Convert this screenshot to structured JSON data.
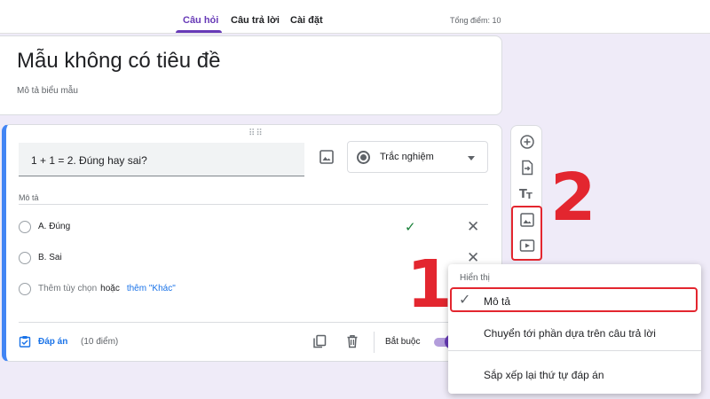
{
  "tabs": [
    {
      "label": "Câu hỏi",
      "active": true
    },
    {
      "label": "Câu trả lời",
      "active": false
    },
    {
      "label": "Cài đặt",
      "active": false
    }
  ],
  "total_points": "Tổng điểm: 10",
  "form": {
    "title": "Mẫu không có tiêu đề",
    "description_placeholder": "Mô tả biểu mẫu"
  },
  "question": {
    "text": "1 + 1 = 2. Đúng hay sai?",
    "type": "Trắc nghiệm",
    "description_placeholder": "Mô tả",
    "options": [
      {
        "label": "A. Đúng",
        "correct": true
      },
      {
        "label": "B. Sai",
        "correct": false
      }
    ],
    "add_option": "Thêm tùy chọn",
    "or_text": "hoặc",
    "add_other": "thêm \"Khác\"",
    "answer_key": "Đáp án",
    "points": "(10 điểm)",
    "required_label": "Bắt buộc",
    "required": true
  },
  "side_toolbar": [
    "add-question-icon",
    "import-questions-icon",
    "add-title-icon",
    "add-image-icon",
    "add-video-icon"
  ],
  "menu": {
    "header": "Hiển thị",
    "items": [
      {
        "label": "Mô tả",
        "checked": true
      },
      {
        "label": "Chuyển tới phần dựa trên câu trả lời",
        "checked": false
      },
      {
        "label": "Sắp xếp lại thứ tự đáp án",
        "checked": false
      }
    ]
  },
  "annotations": {
    "step1": "1",
    "step2": "2"
  },
  "colors": {
    "accent": "#673ab7",
    "link": "#1a73e8",
    "correct": "#188038",
    "annotation": "#e3262f",
    "background": "#efebf8"
  }
}
